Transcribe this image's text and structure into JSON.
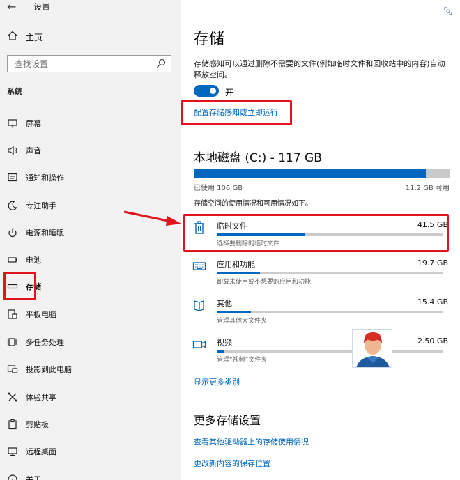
{
  "window": {
    "title": "设置",
    "back_glyph": "←"
  },
  "sidebar": {
    "home": "主页",
    "search_placeholder": "查找设置",
    "section": "系统",
    "items": [
      {
        "label": "屏幕",
        "icon": "monitor-icon"
      },
      {
        "label": "声音",
        "icon": "speaker-icon"
      },
      {
        "label": "通知和操作",
        "icon": "notification-icon"
      },
      {
        "label": "专注助手",
        "icon": "moon-icon"
      },
      {
        "label": "电源和睡眠",
        "icon": "power-icon"
      },
      {
        "label": "电池",
        "icon": "battery-icon"
      },
      {
        "label": "存储",
        "icon": "storage-icon",
        "active": true
      },
      {
        "label": "平板电脑",
        "icon": "tablet-icon"
      },
      {
        "label": "多任务处理",
        "icon": "multitask-icon"
      },
      {
        "label": "投影到此电脑",
        "icon": "project-icon"
      },
      {
        "label": "体验共享",
        "icon": "share-icon"
      },
      {
        "label": "剪贴板",
        "icon": "clipboard-icon"
      },
      {
        "label": "远程桌面",
        "icon": "remote-desktop-icon"
      },
      {
        "label": "关于",
        "icon": "info-icon"
      }
    ]
  },
  "main": {
    "title": "存储",
    "description": "存储感知可以通过删除不需要的文件(例如临时文件和回收站中的内容)自动释放空间。",
    "toggle_state": "开",
    "toggle_on": true,
    "configure_link": "配置存储感知或立即运行",
    "disk": {
      "title": "本地磁盘 (C:) - 117 GB",
      "used_label": "已使用 106 GB",
      "free_label": "11.2 GB 可用",
      "used_fraction": 0.906
    },
    "usage_desc": "存储空间的使用情况和可用情况如下。",
    "categories": [
      {
        "name": "临时文件",
        "size": "41.5 GB",
        "desc": "选择要删除的临时文件",
        "fraction": 0.39,
        "icon": "trash-icon"
      },
      {
        "name": "应用和功能",
        "size": "19.7 GB",
        "desc": "卸载未使用或不想要的应用和功能",
        "fraction": 0.19,
        "icon": "keyboard-icon"
      },
      {
        "name": "其他",
        "size": "15.4 GB",
        "desc": "管理其他大文件夹",
        "fraction": 0.15,
        "icon": "folder-icon"
      },
      {
        "name": "视频",
        "size": "2.50 GB",
        "desc": "管理“视频”文件夹",
        "fraction": 0.03,
        "icon": "video-icon"
      }
    ],
    "show_more": "显示更多类别",
    "more_settings_title": "更多存储设置",
    "link_other_drives": "查看其他驱动器上的存储使用情况",
    "link_save_location": "更改新内容的保存位置"
  }
}
